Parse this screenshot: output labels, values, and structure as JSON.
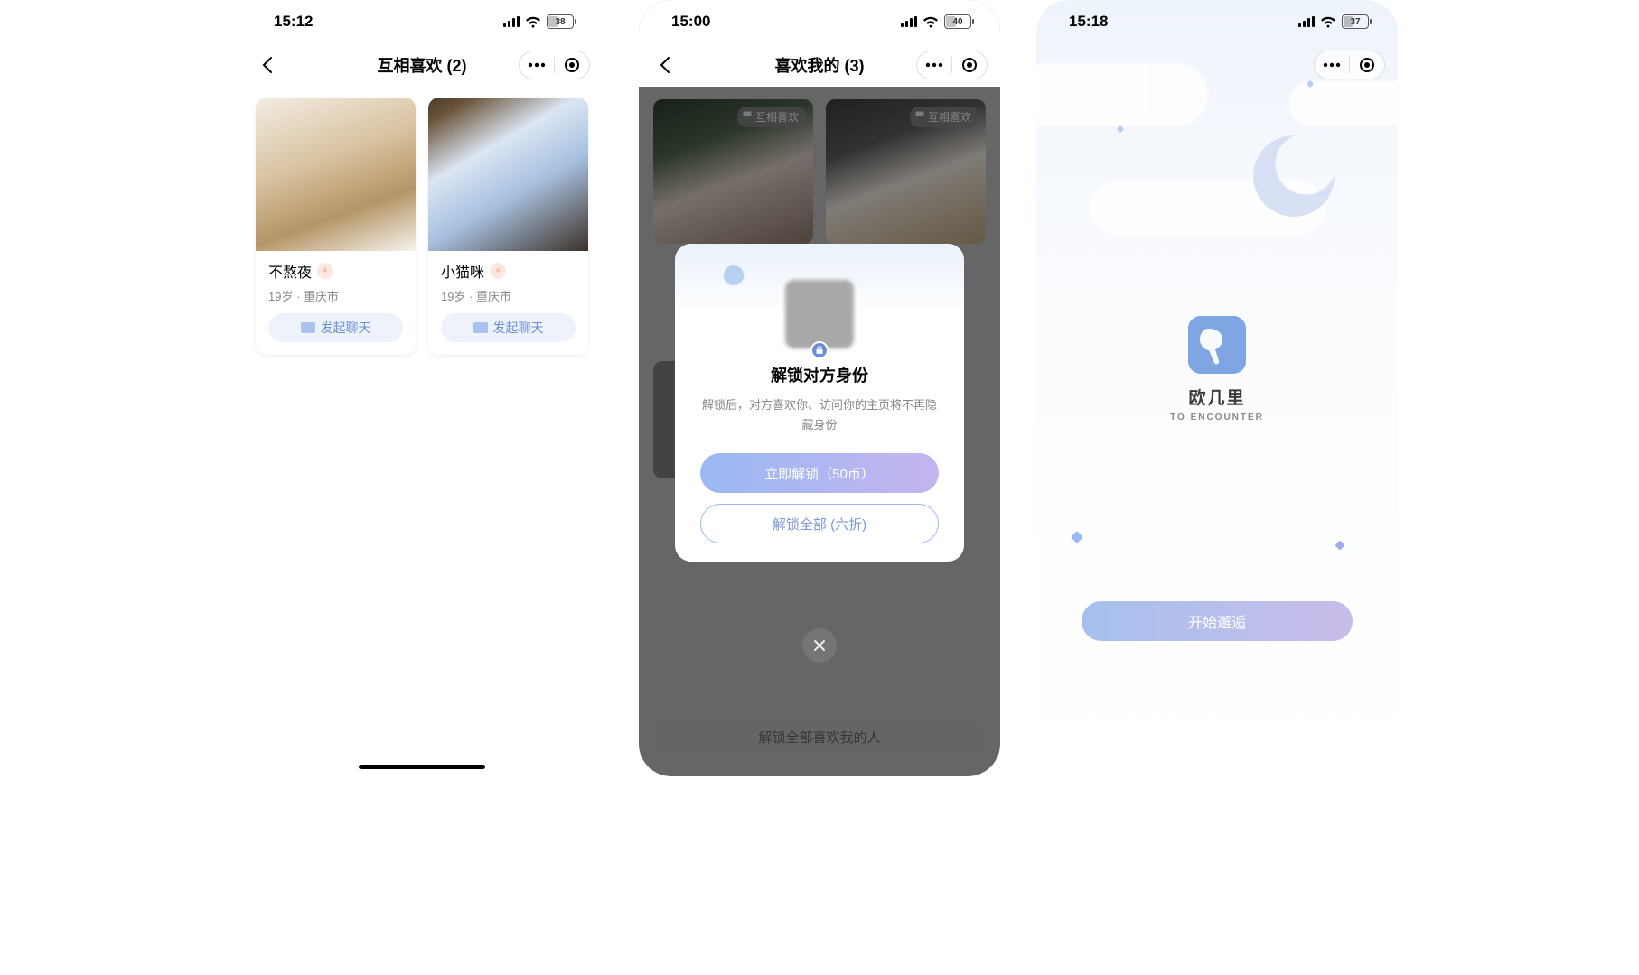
{
  "screen1": {
    "status": {
      "time": "15:12",
      "battery": "38"
    },
    "nav": {
      "title": "互相喜欢 (2)"
    },
    "cards": [
      {
        "name": "不熬夜",
        "meta": "19岁 · 重庆市",
        "cta": "发起聊天"
      },
      {
        "name": "小猫咪",
        "meta": "19岁 · 重庆市",
        "cta": "发起聊天"
      }
    ]
  },
  "screen2": {
    "status": {
      "time": "15:00",
      "battery": "40"
    },
    "nav": {
      "title": "喜欢我的 (3)"
    },
    "mutual_tag": "互相喜欢",
    "modal": {
      "title": "解锁对方身份",
      "desc": "解锁后，对方喜欢你、访问你的主页将不再隐藏身份",
      "primary": "立即解锁（50币）",
      "secondary": "解锁全部 (六折)"
    },
    "bottom_bar": "解锁全部喜欢我的人"
  },
  "screen3": {
    "status": {
      "time": "15:18",
      "battery": "37"
    },
    "app": {
      "name": "欧几里",
      "sub": "TO ENCOUNTER"
    },
    "start": "开始邂逅"
  }
}
